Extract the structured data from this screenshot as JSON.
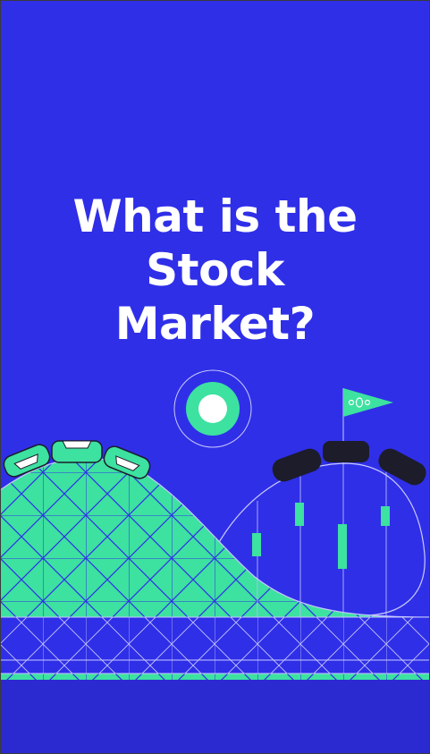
{
  "title_lines": [
    "What is the",
    "Stock",
    "Market?"
  ],
  "colors": {
    "background": "#2f2fe8",
    "background_bottom": "#2a2ad0",
    "accent": "#3de1a0",
    "line": "#c9c9ff",
    "dark_cart": "#1c1c2b",
    "border": "#3a3a3a"
  },
  "icons": {
    "sun": "coin-circle-icon",
    "flag": "pennant-flag-icon"
  }
}
